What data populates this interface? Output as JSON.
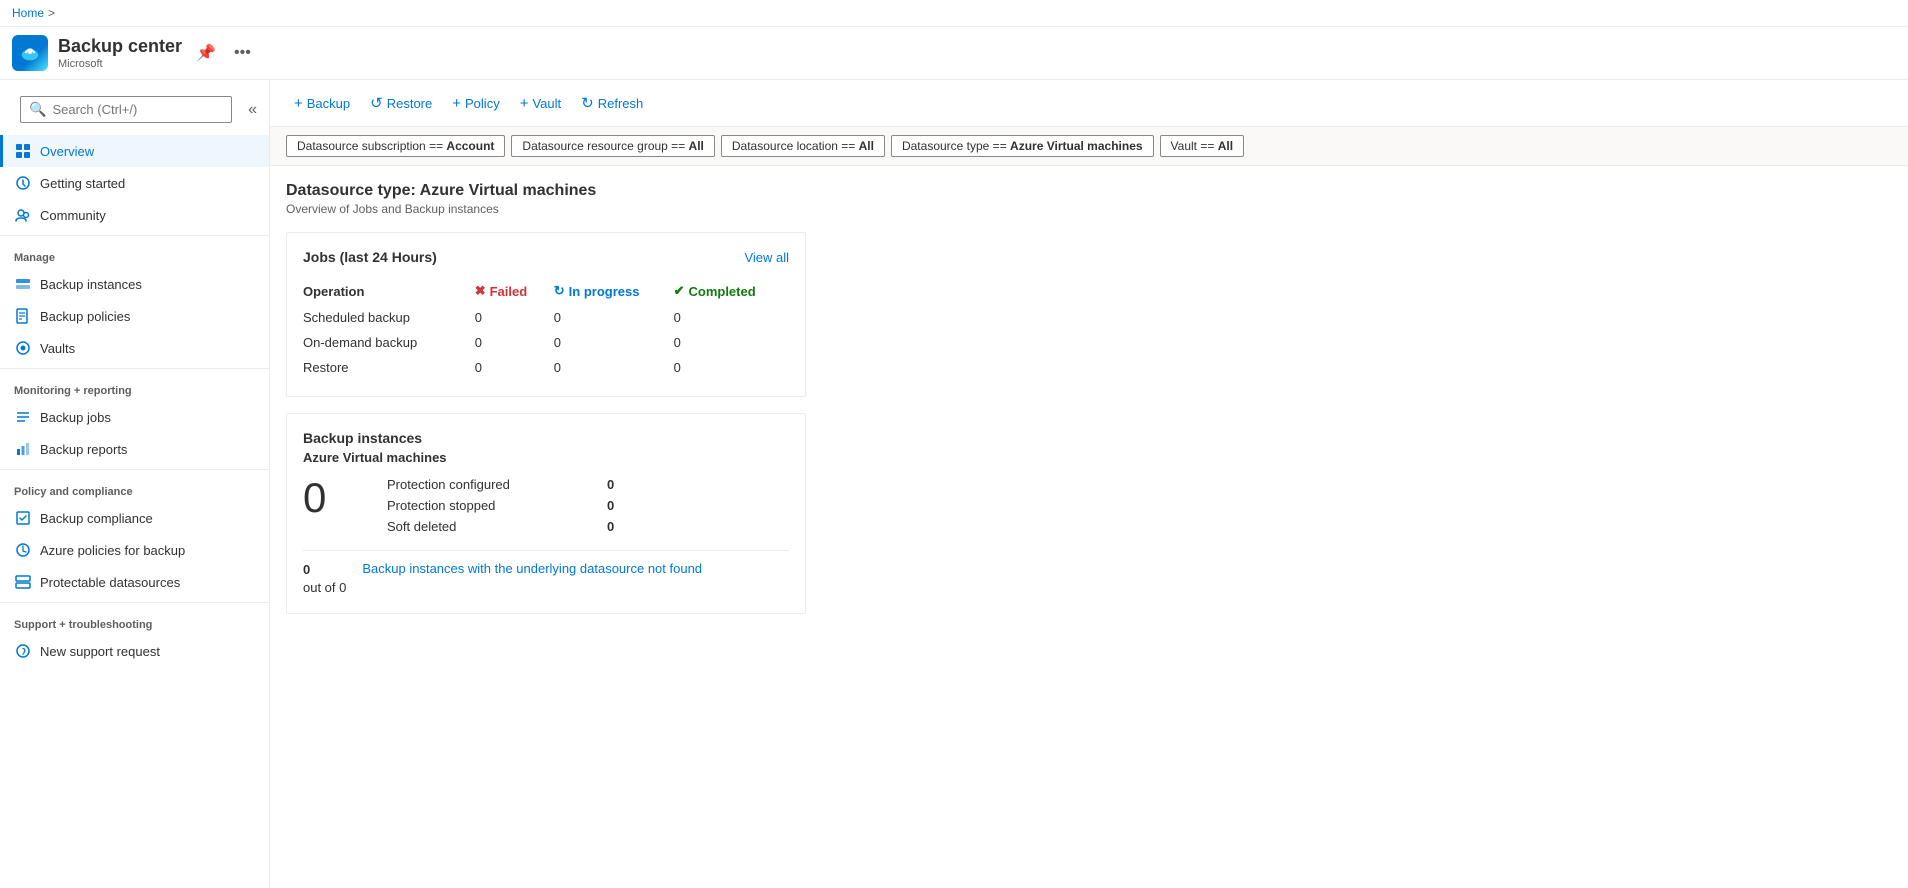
{
  "breadcrumb": {
    "home": "Home",
    "separator": ">"
  },
  "app": {
    "title": "Backup center",
    "subtitle": "Microsoft"
  },
  "sidebar": {
    "search_placeholder": "Search (Ctrl+/)",
    "nav_items": [
      {
        "id": "overview",
        "label": "Overview",
        "active": true,
        "icon": "overview-icon"
      },
      {
        "id": "getting-started",
        "label": "Getting started",
        "active": false,
        "icon": "start-icon"
      },
      {
        "id": "community",
        "label": "Community",
        "active": false,
        "icon": "community-icon"
      }
    ],
    "sections": [
      {
        "label": "Manage",
        "items": [
          {
            "id": "backup-instances",
            "label": "Backup instances",
            "icon": "instances-icon"
          },
          {
            "id": "backup-policies",
            "label": "Backup policies",
            "icon": "policies-icon"
          },
          {
            "id": "vaults",
            "label": "Vaults",
            "icon": "vaults-icon"
          }
        ]
      },
      {
        "label": "Monitoring + reporting",
        "items": [
          {
            "id": "backup-jobs",
            "label": "Backup jobs",
            "icon": "jobs-icon"
          },
          {
            "id": "backup-reports",
            "label": "Backup reports",
            "icon": "reports-icon"
          }
        ]
      },
      {
        "label": "Policy and compliance",
        "items": [
          {
            "id": "backup-compliance",
            "label": "Backup compliance",
            "icon": "compliance-icon"
          },
          {
            "id": "azure-policies",
            "label": "Azure policies for backup",
            "icon": "azure-policy-icon"
          },
          {
            "id": "protectable-datasources",
            "label": "Protectable datasources",
            "icon": "datasource-icon"
          }
        ]
      },
      {
        "label": "Support + troubleshooting",
        "items": [
          {
            "id": "new-support-request",
            "label": "New support request",
            "icon": "support-icon"
          }
        ]
      }
    ]
  },
  "toolbar": {
    "buttons": [
      {
        "id": "backup-btn",
        "label": "Backup",
        "icon": "+"
      },
      {
        "id": "restore-btn",
        "label": "Restore",
        "icon": "↺"
      },
      {
        "id": "policy-btn",
        "label": "Policy",
        "icon": "+"
      },
      {
        "id": "vault-btn",
        "label": "Vault",
        "icon": "+"
      },
      {
        "id": "refresh-btn",
        "label": "Refresh",
        "icon": "↻"
      }
    ]
  },
  "filters": [
    {
      "id": "datasource-subscription",
      "label": "Datasource subscription == ",
      "bold": "Account"
    },
    {
      "id": "datasource-resource-group",
      "label": "Datasource resource group == ",
      "bold": "All"
    },
    {
      "id": "datasource-location",
      "label": "Datasource location == ",
      "bold": "All"
    },
    {
      "id": "datasource-type",
      "label": "Datasource type == ",
      "bold": "Azure Virtual machines"
    },
    {
      "id": "vault",
      "label": "Vault == ",
      "bold": "All"
    }
  ],
  "main": {
    "page_title": "Datasource type: Azure Virtual machines",
    "page_subtitle": "Overview of Jobs and Backup instances",
    "jobs_card": {
      "title": "Jobs (last 24 Hours)",
      "view_all": "View all",
      "columns": [
        {
          "id": "operation",
          "label": "Operation"
        },
        {
          "id": "failed",
          "label": "Failed",
          "status": "failed"
        },
        {
          "id": "in_progress",
          "label": "In progress",
          "status": "inprogress"
        },
        {
          "id": "completed",
          "label": "Completed",
          "status": "completed"
        }
      ],
      "rows": [
        {
          "operation": "Scheduled backup",
          "failed": "0",
          "in_progress": "0",
          "completed": "0"
        },
        {
          "operation": "On-demand backup",
          "failed": "0",
          "in_progress": "0",
          "completed": "0"
        },
        {
          "operation": "Restore",
          "failed": "0",
          "in_progress": "0",
          "completed": "0"
        }
      ]
    },
    "backup_instances_card": {
      "title": "Backup instances",
      "subtitle": "Azure Virtual machines",
      "big_count": "0",
      "stats": [
        {
          "label": "Protection configured",
          "value": "0"
        },
        {
          "label": "Protection stopped",
          "value": "0"
        },
        {
          "label": "Soft deleted",
          "value": "0"
        }
      ],
      "footer": {
        "count": "0",
        "out_of": "out of 0",
        "label": "Backup instances with the underlying datasource not found"
      }
    }
  }
}
